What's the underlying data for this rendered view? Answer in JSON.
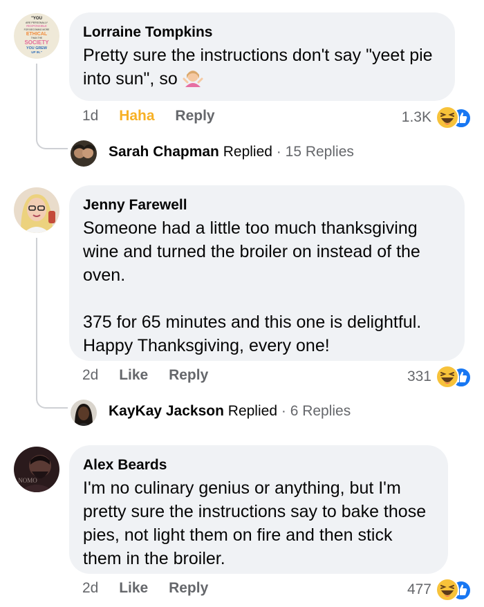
{
  "comments": [
    {
      "author": "Lorraine Tompkins",
      "text": "Pretty sure the instructions don't say \"yeet pie into sun\", so",
      "emoji": "person-shrugging",
      "time": "1d",
      "reaction_label": "Haha",
      "reply_label": "Reply",
      "reaction_count": "1.3K",
      "reply_thread": {
        "name": "Sarah Chapman",
        "action": "Replied",
        "sep": "·",
        "count": "15 Replies"
      }
    },
    {
      "author": "Jenny Farewell",
      "text1": "Someone had a little too much thanksgiving wine and turned the broiler on instead of the oven.",
      "text2": "375 for 65 minutes and this one is delightful. Happy Thanksgiving, every one!",
      "time": "2d",
      "like_label": "Like",
      "reply_label": "Reply",
      "reaction_count": "331",
      "reply_thread": {
        "name": "KayKay Jackson",
        "action": "Replied",
        "sep": "·",
        "count": "6 Replies"
      }
    },
    {
      "author": "Alex Beards",
      "text": "I'm no culinary genius or anything, but I'm pretty sure the instructions say to bake those pies, not light them on fire and then stick them in the broiler.",
      "time": "2d",
      "like_label": "Like",
      "reply_label": "Reply",
      "reaction_count": "477"
    }
  ],
  "avatars": {
    "lorraine_badge_text": [
      "\"YOU",
      "ARE PERSONALLY",
      "RESPONSIBLE",
      "FOR BECOMING MORE",
      "ETHICAL",
      "THAN THE",
      "SOCIETY",
      "YOU GREW",
      "UP IN.\""
    ],
    "alex_watermark": "NOMO"
  },
  "colors": {
    "bubble": "#f0f2f5",
    "meta": "#65676b",
    "haha_active": "#f7b125",
    "like_blue": "#1877f2",
    "thread_line": "#ced0d4"
  }
}
